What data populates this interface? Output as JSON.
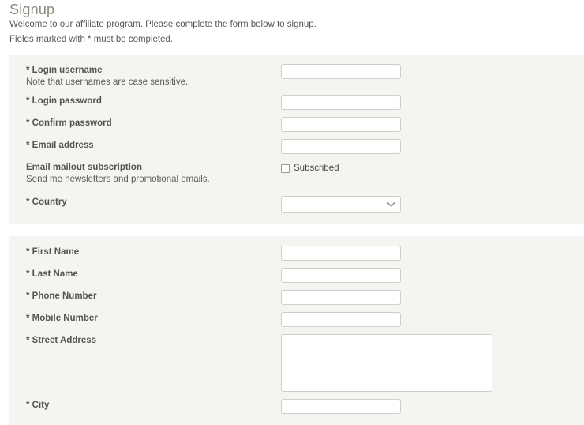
{
  "page": {
    "title": "Signup",
    "intro_line_1": "Welcome to our affiliate program. Please complete the form below to signup.",
    "intro_line_2": "Fields marked with * must be completed."
  },
  "colors": {
    "panel_background": "#f4f4f1",
    "page_background": "#ffffff",
    "title_text": "#8a887c",
    "label_text": "#55554d",
    "body_text": "#56564e",
    "input_border": "#cfcfc9",
    "input_background": "#ffffff"
  },
  "account_panel": {
    "fields": [
      {
        "label": "* Login username",
        "hint": "Note that usernames are case sensitive.",
        "control": "text",
        "value": "",
        "placeholder": ""
      },
      {
        "label": "* Login password",
        "hint": "",
        "control": "password",
        "value": "",
        "placeholder": ""
      },
      {
        "label": "* Confirm password",
        "hint": "",
        "control": "password",
        "value": "",
        "placeholder": ""
      },
      {
        "label": "* Email address",
        "hint": "",
        "control": "text",
        "value": "",
        "placeholder": ""
      },
      {
        "label": "Email mailout subscription",
        "hint": "Send me newsletters and promotional emails.",
        "control": "checkbox",
        "checkbox_label": "Subscribed",
        "checked": false
      },
      {
        "label": "* Country",
        "hint": "",
        "control": "select",
        "selected_option": "",
        "chevron_icon": "chevron-down-icon"
      }
    ]
  },
  "contact_panel": {
    "fields": [
      {
        "label": "* First Name",
        "hint": "",
        "control": "text",
        "value": "",
        "placeholder": ""
      },
      {
        "label": "* Last Name",
        "hint": "",
        "control": "text",
        "value": "",
        "placeholder": ""
      },
      {
        "label": "* Phone Number",
        "hint": "",
        "control": "text",
        "value": "",
        "placeholder": ""
      },
      {
        "label": "* Mobile Number",
        "hint": "",
        "control": "text",
        "value": "",
        "placeholder": ""
      },
      {
        "label": "* Street Address",
        "hint": "",
        "control": "textarea",
        "value": "",
        "placeholder": ""
      },
      {
        "label": "* City",
        "hint": "",
        "control": "text",
        "value": "",
        "placeholder": ""
      }
    ]
  }
}
